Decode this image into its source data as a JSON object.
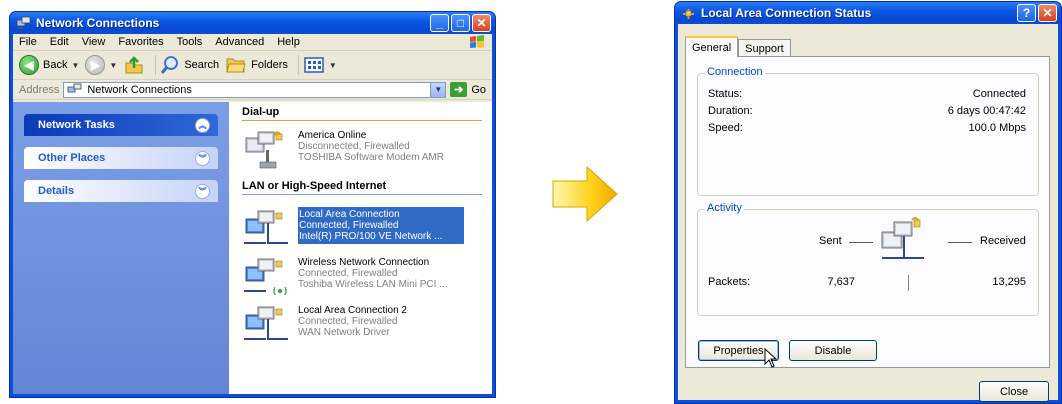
{
  "network_window": {
    "title": "Network Connections",
    "menu": [
      "File",
      "Edit",
      "View",
      "Favorites",
      "Tools",
      "Advanced",
      "Help"
    ],
    "toolbar": {
      "back": "Back",
      "search": "Search",
      "folders": "Folders"
    },
    "address": {
      "label": "Address",
      "value": "Network Connections",
      "go": "Go"
    },
    "tasks": [
      "Network Tasks",
      "Other Places",
      "Details"
    ],
    "groups": {
      "dialup": {
        "heading": "Dial-up",
        "items": [
          {
            "name": "America Online",
            "status": "Disconnected, Firewalled",
            "device": "TOSHIBA Software Modem AMR"
          }
        ]
      },
      "lan": {
        "heading": "LAN or High-Speed Internet",
        "items": [
          {
            "name": "Local Area Connection",
            "status": "Connected, Firewalled",
            "device": "Intel(R) PRO/100 VE Network ..."
          },
          {
            "name": "Wireless Network Connection",
            "status": "Connected, Firewalled",
            "device": "Toshiba Wireless LAN Mini PCI ..."
          },
          {
            "name": "Local Area Connection 2",
            "status": "Connected, Firewalled",
            "device": "WAN Network Driver"
          }
        ]
      }
    }
  },
  "status_window": {
    "title": "Local Area Connection Status",
    "tabs": [
      "General",
      "Support"
    ],
    "connection": {
      "legend": "Connection",
      "status_label": "Status:",
      "status_value": "Connected",
      "duration_label": "Duration:",
      "duration_value": "6 days 00:47:42",
      "speed_label": "Speed:",
      "speed_value": "100.0 Mbps"
    },
    "activity": {
      "legend": "Activity",
      "sent_label": "Sent",
      "received_label": "Received",
      "packets_label": "Packets:",
      "packets_sent": "7,637",
      "packets_received": "13,295"
    },
    "buttons": {
      "properties": "Properties",
      "disable": "Disable",
      "close": "Close"
    }
  },
  "colors": {
    "title_blue": "#0a50d8",
    "task_pane": "#7b9fe6",
    "selection": "#316ac5",
    "legend_blue": "#0046d5"
  }
}
